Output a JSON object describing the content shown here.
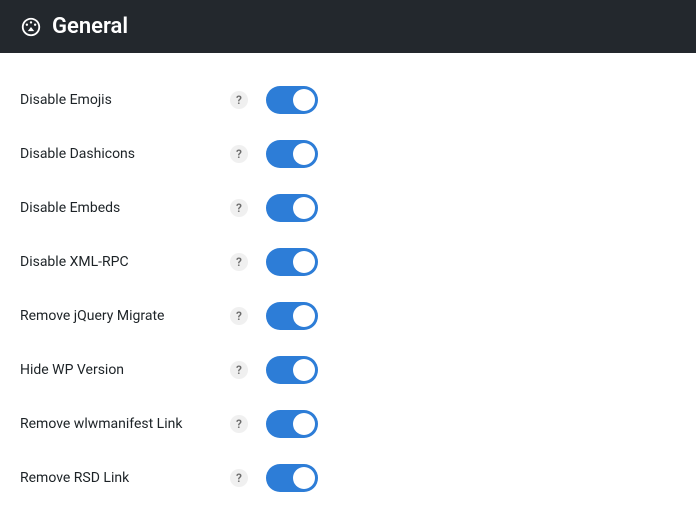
{
  "header": {
    "title": "General",
    "icon": "gauge-icon"
  },
  "help_glyph": "?",
  "settings": [
    {
      "label": "Disable Emojis",
      "enabled": true
    },
    {
      "label": "Disable Dashicons",
      "enabled": true
    },
    {
      "label": "Disable Embeds",
      "enabled": true
    },
    {
      "label": "Disable XML-RPC",
      "enabled": true
    },
    {
      "label": "Remove jQuery Migrate",
      "enabled": true
    },
    {
      "label": "Hide WP Version",
      "enabled": true
    },
    {
      "label": "Remove wlwmanifest Link",
      "enabled": true
    },
    {
      "label": "Remove RSD Link",
      "enabled": true
    }
  ]
}
